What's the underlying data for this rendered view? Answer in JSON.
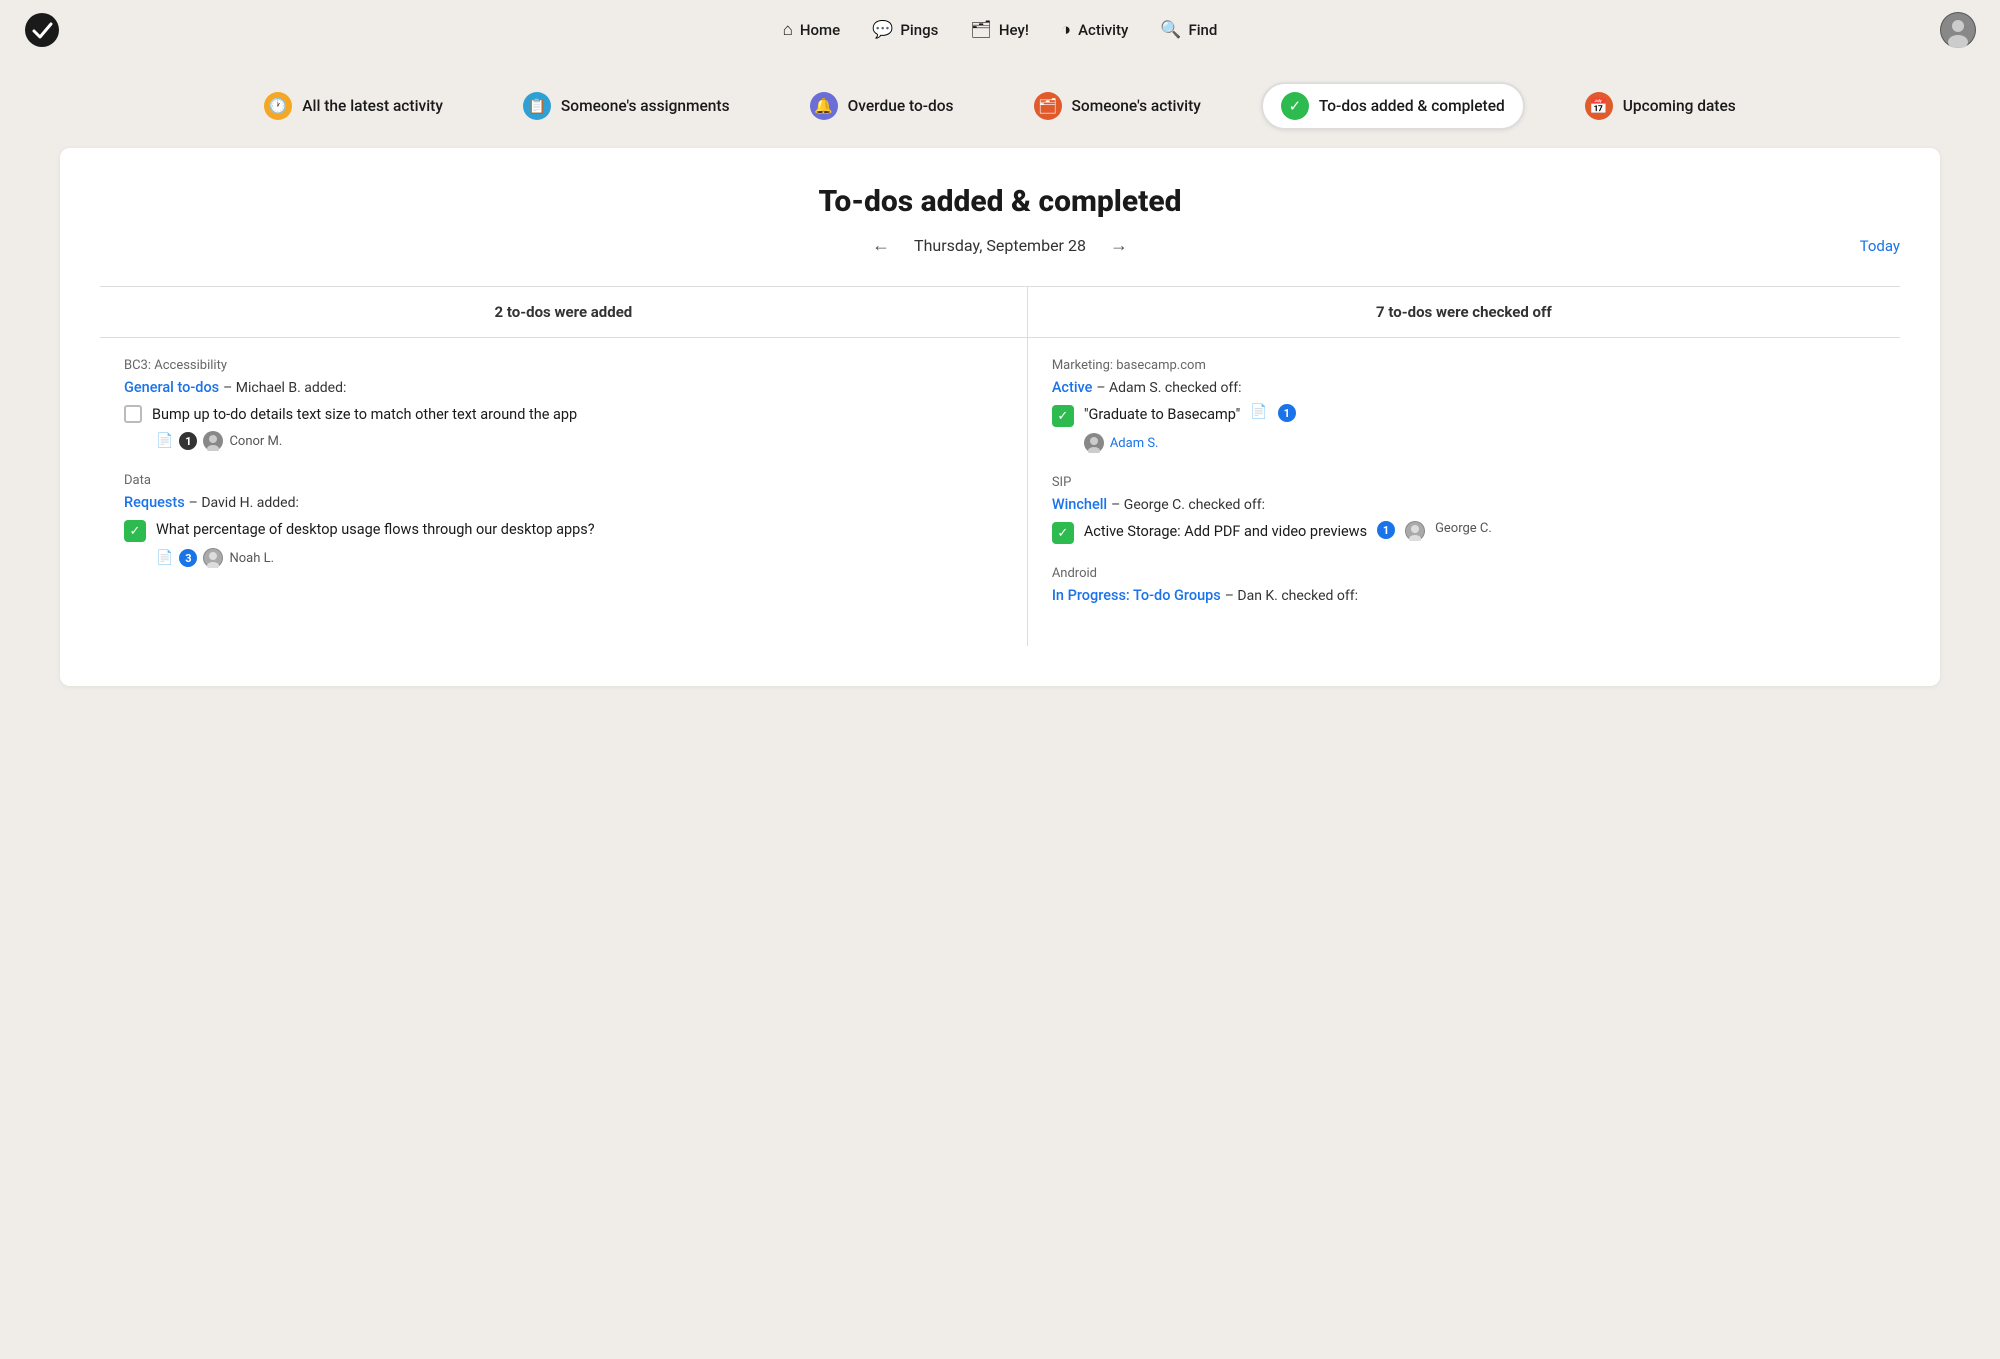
{
  "nav": {
    "logo_alt": "Basecamp logo",
    "items": [
      {
        "id": "home",
        "label": "Home",
        "icon": "⌂"
      },
      {
        "id": "pings",
        "label": "Pings",
        "icon": "💬"
      },
      {
        "id": "hey",
        "label": "Hey!",
        "icon": "🗂"
      },
      {
        "id": "activity",
        "label": "Activity",
        "icon": "◑"
      },
      {
        "id": "find",
        "label": "Find",
        "icon": "🔍"
      }
    ]
  },
  "filters": [
    {
      "id": "latest",
      "label": "All the latest activity",
      "icon": "🕐",
      "icon_class": "icon-yellow",
      "active": false
    },
    {
      "id": "assignments",
      "label": "Someone's assignments",
      "icon": "📋",
      "icon_class": "icon-blue",
      "active": false
    },
    {
      "id": "overdue",
      "label": "Overdue to-dos",
      "icon": "🔔",
      "icon_class": "icon-purple",
      "active": false
    },
    {
      "id": "someones-activity",
      "label": "Someone's activity",
      "icon": "🗂",
      "icon_class": "icon-orange",
      "active": false
    },
    {
      "id": "todos-added",
      "label": "To-dos added & completed",
      "icon": "✓",
      "icon_class": "icon-green",
      "active": true
    },
    {
      "id": "upcoming",
      "label": "Upcoming dates",
      "icon": "📅",
      "icon_class": "icon-red-border",
      "active": false
    }
  ],
  "page": {
    "title": "To-dos added & completed",
    "date": "Thursday, September 28",
    "today_label": "Today",
    "added_header": "2 to-dos were added",
    "checked_header": "7 to-dos were checked off"
  },
  "added_todos": [
    {
      "project": "BC3: Accessibility",
      "list_link": "General to-dos",
      "added_by": "Michael B. added:",
      "checked": false,
      "text": "Bump up to-do details text size to match other text around the app",
      "comment_count": "1",
      "assignee": "Conor M."
    },
    {
      "project": "Data",
      "list_link": "Requests",
      "added_by": "David H. added:",
      "checked": true,
      "text": "What percentage of desktop usage flows through our desktop apps?",
      "comment_count": "3",
      "assignee": "Noah L."
    }
  ],
  "checked_todos": [
    {
      "project": "Marketing: basecamp.com",
      "list_link": "Active",
      "checked_by": "Adam S. checked off:",
      "checked": true,
      "text": "\"Graduate to Basecamp\"",
      "comment_count": "1",
      "assignee": "Adam S.",
      "assignee_color": "blue"
    },
    {
      "project": "SIP",
      "list_link": "Winchell",
      "checked_by": "George C. checked off:",
      "checked": true,
      "text": "Active Storage: Add PDF and video previews",
      "comment_count": "1",
      "assignee": "George C."
    },
    {
      "project": "Android",
      "list_link": "In Progress: To-do Groups",
      "checked_by": "Dan K. checked off:",
      "checked": false,
      "text": ""
    }
  ]
}
